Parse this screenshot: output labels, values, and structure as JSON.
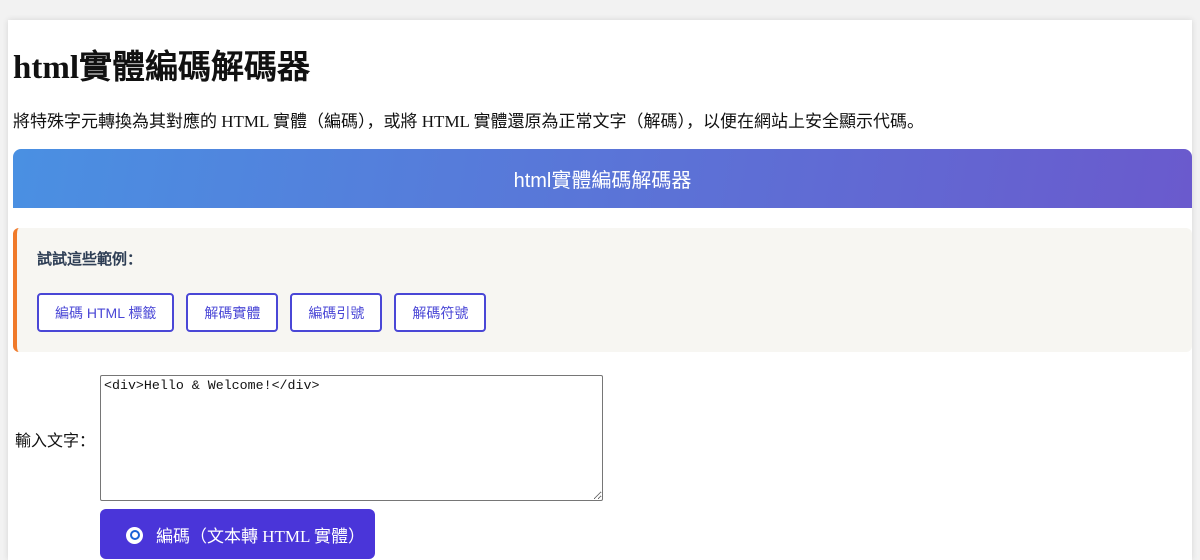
{
  "page": {
    "title": "html實體編碼解碼器",
    "description": "將特殊字元轉換為其對應的 HTML 實體（編碼），或將 HTML 實體還原為正常文字（解碼），以便在網站上安全顯示代碼。"
  },
  "banner": {
    "title": "html實體編碼解碼器",
    "gradient_start": "#4a90e2",
    "gradient_end": "#6a5acd"
  },
  "examples": {
    "heading": "試試這些範例：",
    "accent_color": "#f07a2a",
    "buttons": [
      {
        "label": "編碼 HTML 標籤"
      },
      {
        "label": "解碼實體"
      },
      {
        "label": "編碼引號"
      },
      {
        "label": "解碼符號"
      }
    ]
  },
  "input": {
    "label": "輸入文字：",
    "value": "<div>Hello & Welcome!</div>"
  },
  "mode": {
    "selected_label": "編碼（文本轉 HTML 實體）",
    "color": "#4a35d9"
  }
}
